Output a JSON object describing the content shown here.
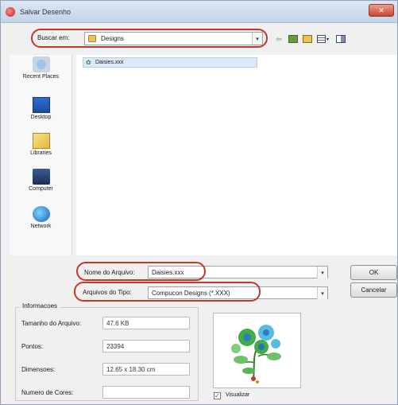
{
  "window": {
    "title": "Salvar Desenho",
    "close_symbol": "✕"
  },
  "lookin": {
    "label": "Buscar em:",
    "value": "Designs",
    "arrow": "▾"
  },
  "toolbar": {
    "back_symbol": "⇦",
    "view_arrow": "▾"
  },
  "places": [
    {
      "label": "Recent Places",
      "icon": "recent-places-icon"
    },
    {
      "label": "Desktop",
      "icon": "desktop-icon"
    },
    {
      "label": "Libraries",
      "icon": "libraries-icon"
    },
    {
      "label": "Computer",
      "icon": "computer-icon"
    },
    {
      "label": "Network",
      "icon": "network-icon"
    }
  ],
  "files": [
    {
      "name": "Daisies.xxx",
      "icon": "design-file-icon",
      "selected": true
    }
  ],
  "filename": {
    "label": "Nome do Arquivo:",
    "value": "Daisies.xxx",
    "arrow": "▾"
  },
  "filetype": {
    "label": "Arquivos do Tipo:",
    "value": "Compucon Designs (*.XXX)",
    "arrow": "▾"
  },
  "buttons": {
    "ok": "OK",
    "cancel": "Cancelar"
  },
  "info": {
    "title": "Informacoes",
    "rows": [
      {
        "label": "Tamanho do Arquivo:",
        "value": "47.6 KB"
      },
      {
        "label": "Pontos:",
        "value": "23394"
      },
      {
        "label": "Dimensoes:",
        "value": "12.65 x 18.30 cm"
      },
      {
        "label": "Numero de Cores:",
        "value": ""
      }
    ]
  },
  "preview": {
    "checkbox_label": "Visualizar",
    "checked": true,
    "check_symbol": "✓"
  },
  "colors": {
    "highlight": "#c0392b",
    "selection": "#dde9f8",
    "embroidery_green": "#3fae45",
    "embroidery_blue": "#2f7fc0"
  }
}
